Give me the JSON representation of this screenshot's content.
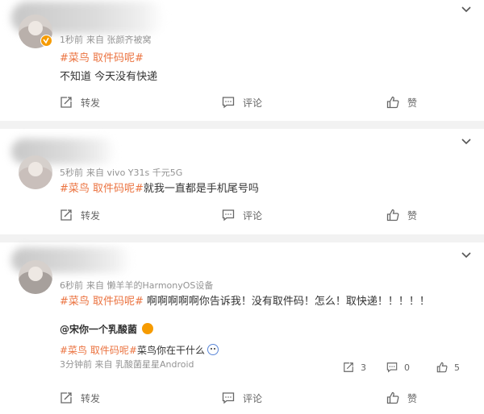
{
  "comments": [
    {
      "meta_time": "1秒前",
      "meta_source": "来自 张颜齐被窝",
      "topic": "#菜鸟 取件码呢#",
      "text": "不知道 今天没有快递",
      "actions": {
        "repost": "转发",
        "comment": "评论",
        "like": "赞"
      }
    },
    {
      "meta_time": "5秒前",
      "meta_source": "来自 vivo Y31s 千元5G",
      "topic": "#菜鸟 取件码呢#",
      "text": "就我一直都是手机尾号吗",
      "actions": {
        "repost": "转发",
        "comment": "评论",
        "like": "赞"
      }
    },
    {
      "meta_time": "6秒前",
      "meta_source": "来自 懒羊羊的HarmonyOS设备",
      "topic": "#菜鸟 取件码呢#",
      "text": "啊啊啊啊啊你告诉我！没有取件码！怎么！取快递！！！！！",
      "quoted": {
        "handle": "@宋你一个乳酸菌",
        "topic": "#菜鸟 取件码呢#",
        "text": "菜鸟你在干什么",
        "meta": "3分钟前 来自 乳酸菌星星Android",
        "repost_count": "3",
        "comment_count": "0",
        "like_count": "5"
      },
      "actions": {
        "repost": "转发",
        "comment": "评论",
        "like": "赞"
      }
    }
  ],
  "icons": {
    "chevron": "chevron-down-icon",
    "repost": "repost-icon",
    "comment": "comment-icon",
    "like": "thumbs-up-icon",
    "verified": "verified-badge-icon"
  },
  "colors": {
    "topic": "#eb7340",
    "badge": "#f69b00",
    "meta": "#939393"
  }
}
